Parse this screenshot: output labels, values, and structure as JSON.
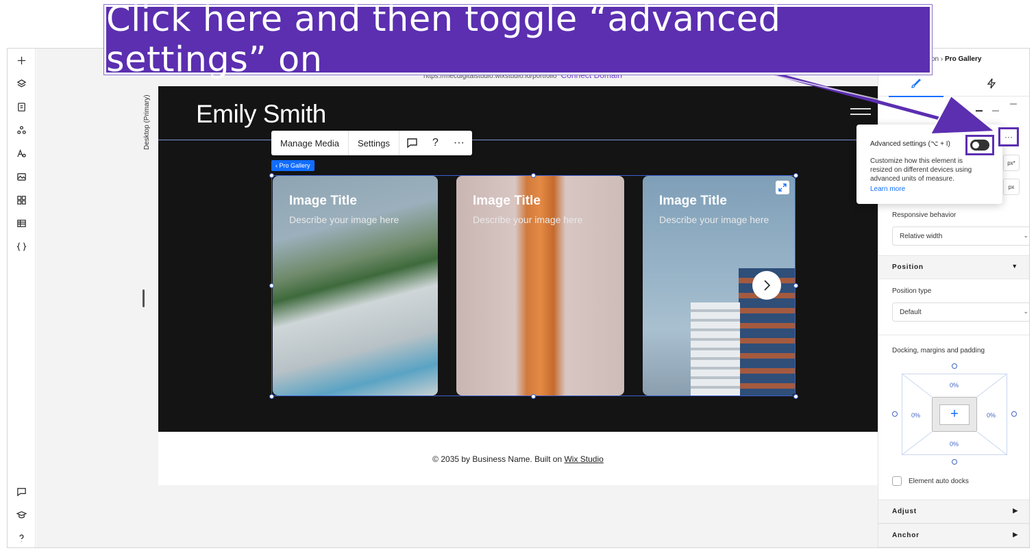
{
  "banner": {
    "text": "Click here and then toggle “advanced settings” on"
  },
  "canvas": {
    "breakpoint_label": "Desktop (Primary)",
    "url": "https://mecdigitalstudio.wixstudio.io/portfolio",
    "connect_domain": "Connect Domain"
  },
  "site": {
    "name": "Emily Smith",
    "footer_prefix": "© 2035 by Business Name. Built on ",
    "footer_link": "Wix Studio"
  },
  "toolbar": {
    "manage_media": "Manage Media",
    "settings": "Settings",
    "help": "?",
    "more": "···"
  },
  "selection_tag": "‹ Pro Gallery",
  "gallery": {
    "cards": [
      {
        "title": "Image Title",
        "desc": "Describe your image here"
      },
      {
        "title": "Image Title",
        "desc": "Describe your image here"
      },
      {
        "title": "Image Title",
        "desc": "Describe your image here"
      }
    ]
  },
  "panel": {
    "breadcrumb_prefix": "tion",
    "breadcrumb_sep": "›",
    "breadcrumb_current": "Pro Gallery",
    "unit_1": "px*",
    "unit_2": "px",
    "responsive_label": "Responsive behavior",
    "responsive_value": "Relative width",
    "position_head": "Position",
    "position_type_label": "Position type",
    "position_type_value": "Default",
    "docking_label": "Docking, margins and padding",
    "dock_top": "0%",
    "dock_left": "0%",
    "dock_right": "0%",
    "dock_bottom": "0%",
    "auto_docks": "Element auto docks",
    "adjust_head": "Adjust",
    "anchor_head": "Anchor"
  },
  "popover": {
    "title": "Advanced settings (⌥ + I)",
    "body": "Customize how this element is resized on different devices using advanced units of measure.",
    "learn_more": "Learn more",
    "more_btn": "···"
  },
  "colors": {
    "accent": "#116dff",
    "callout": "#5b2fb0",
    "canvas_dark": "#141414"
  }
}
